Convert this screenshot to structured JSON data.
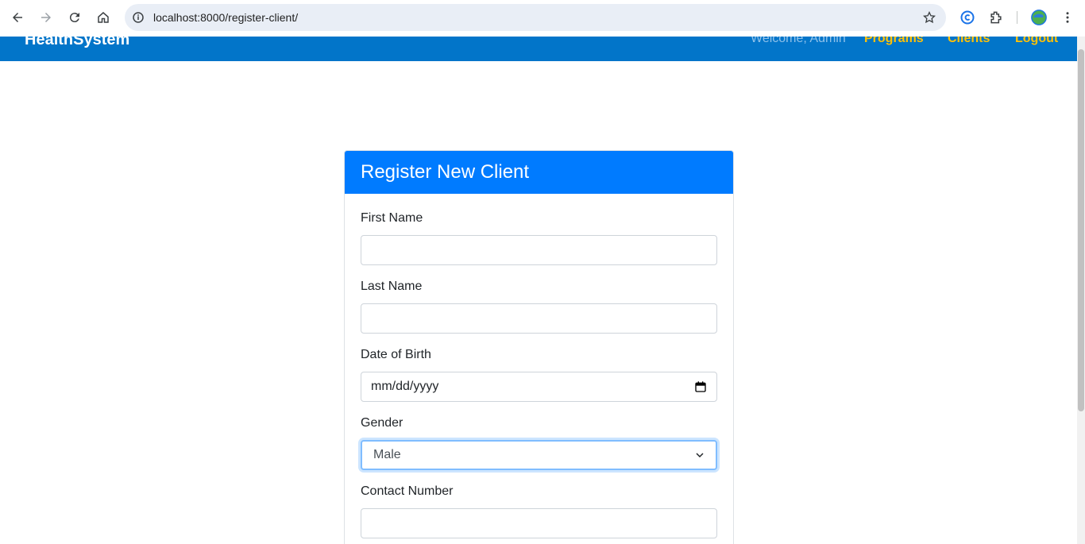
{
  "browser": {
    "url": "localhost:8000/register-client/"
  },
  "app": {
    "brand": "HealthSystem",
    "welcome": "Welcome, Admin",
    "nav": [
      "Programs",
      "Clients",
      "Logout"
    ]
  },
  "form": {
    "title": "Register New Client",
    "fields": {
      "first_name": {
        "label": "First Name",
        "value": ""
      },
      "last_name": {
        "label": "Last Name",
        "value": ""
      },
      "dob": {
        "label": "Date of Birth",
        "placeholder": "mm/dd/yyyy"
      },
      "gender": {
        "label": "Gender",
        "selected": "Male"
      },
      "contact": {
        "label": "Contact Number",
        "value": ""
      }
    }
  },
  "colors": {
    "appbar": "#0275c9",
    "card_header": "#007bff",
    "nav_link": "#ffc107"
  }
}
